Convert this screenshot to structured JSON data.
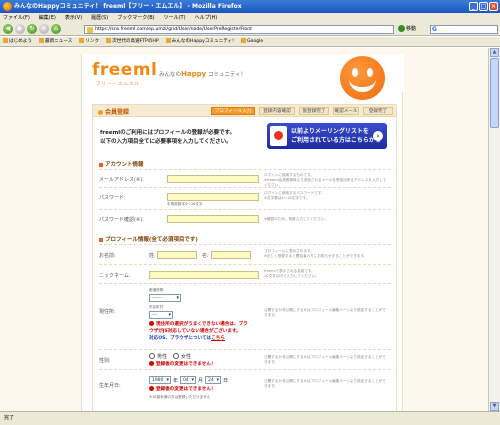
{
  "window": {
    "title": "みんなのHappyコミュニティ！ freeml【フリー・エムエル】 - Mozilla Firefox"
  },
  "menu": [
    "ファイル(F)",
    "編集(E)",
    "表示(V)",
    "履歴(S)",
    "ブックマーク(B)",
    "ツール(T)",
    "ヘルプ(H)"
  ],
  "nav": {
    "url": "https://sns.freeml.com/ep.umzi/grid/User/node/UserPreRegisterFront",
    "go_label": "移動",
    "search_glyph": "G"
  },
  "bookmarks": [
    "はじめよう",
    "最新ニュース",
    "リンク",
    "次世代の高速FTPのHP",
    "みんなのHappyコミュニティ!",
    "Google"
  ],
  "site": {
    "logo": "freeml",
    "logo_sub": "フリー・エムエル",
    "tagline_prefix": "みんなの",
    "tagline_happy": "Happy",
    "tagline_suffix": " コミュニティ！"
  },
  "panel": {
    "title": "会員登録",
    "steps": [
      "プロフィール入力",
      "登録内容確認",
      "仮登録完了",
      "確認メール",
      "登録完了"
    ],
    "intro": "freemlのご利用にはプロフィールの登録が必要です。\n以下の入力項目全てに必要事項を入力してください。",
    "banner_line1": "以前よりメーリングリストを",
    "banner_line2": "ご利用されている方はこちらから",
    "banner_arrow": "›"
  },
  "account": {
    "title": "アカウント情報",
    "email_label": "メールアドレス(※):",
    "email_note": "ログインに使用するものです。\n※freeml会員登録時より送信されるメールを受信出来るアドレスを入力してください。",
    "password_label": "パスワード:",
    "password_hint": "半角英数字4〜16文字",
    "password_note": "ログインに使用するパスワードです。\n※文字数は4〜16文字です。",
    "password_confirm_label": "パスワード確認(※):",
    "password_confirm_note": "※確認のため、再度入力してください。"
  },
  "profile": {
    "title": "プロフィール情報(全て必須項目です)",
    "name_label": "お名前:",
    "last_label": "姓:",
    "first_label": "名:",
    "name_note": "プロフィールに表示されます。\n※正しく登録すると閲覧者の方にお知らせすることができます。",
    "nickname_label": "ニックネーム:",
    "nickname_note": "freemlで表示される名前です。\n10文字以内で入力してください。",
    "address_label": "現住所:",
    "pref_label": "都道府県",
    "pref_value": "------",
    "city_label": "市区町村",
    "city_value": "---",
    "address_error_line1": "現住所の選択がうまくできない場合は、ブラ",
    "address_error_line2": "ウザがJS対応していない場合がございます。",
    "address_error_line3": "対応OS、ブラウザについては",
    "address_error_link": "こちら",
    "address_note": "公開するか非公開にするかはプロフィール編集ページより設定することができます。",
    "gender_label": "性別:",
    "gender_male": "男性",
    "gender_female": "女性",
    "gender_error": "登録後の変更はできません！",
    "gender_note": "公開するか非公開にするかはプロフィール編集ページより設定することができます。",
    "birth_label": "生年月日:",
    "birth_year": "1980",
    "birth_year_unit": "年",
    "birth_month": "04",
    "birth_month_unit": "月",
    "birth_day": "24",
    "birth_day_unit": "日",
    "birth_error": "登録後の変更はできません！",
    "birth_hint": "※18歳未満の方は登録いただけません",
    "birth_note": "公開するか非公開にするかはプロフィール編集ページより設定することができます。"
  },
  "status": "完了"
}
